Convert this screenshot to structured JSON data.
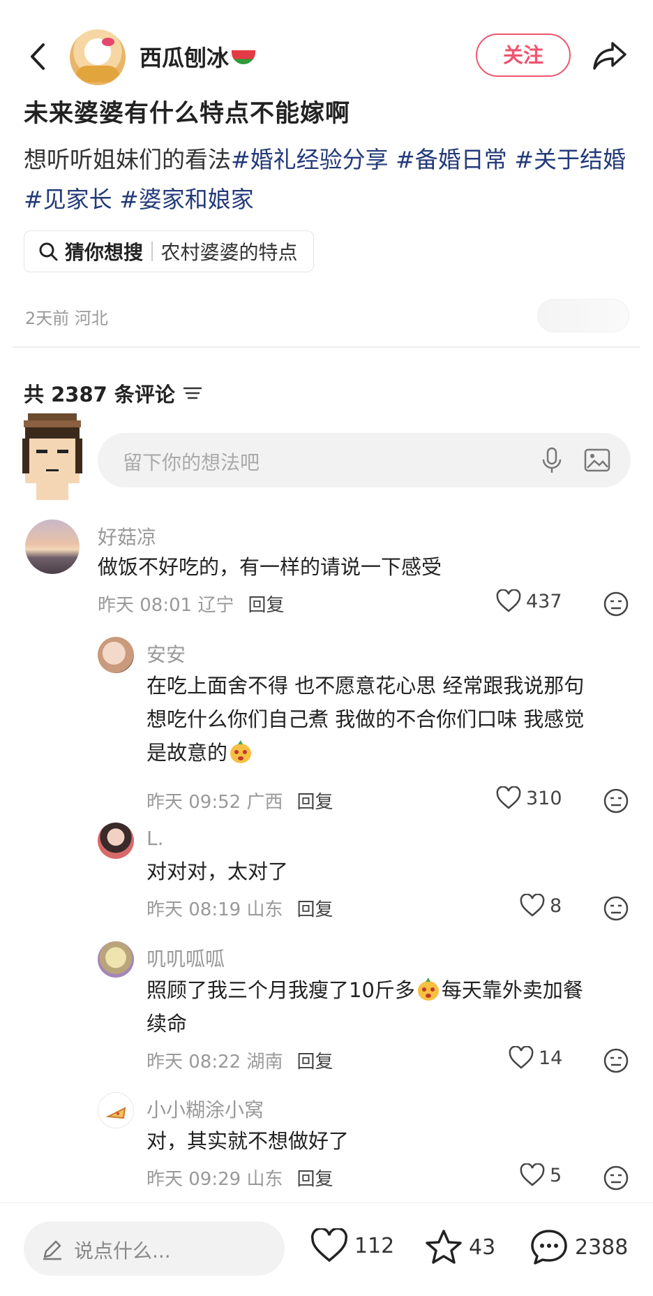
{
  "header": {
    "author_name": "西瓜刨冰",
    "author_emoji": "watermelon-icon",
    "follow_label": "关注"
  },
  "post": {
    "title": "未来婆婆有什么特点不能嫁啊",
    "body_text": "想听听姐妹们的看法",
    "tags": [
      "#婚礼经验分享",
      "#备婚日常",
      "#关于结婚",
      "#见家长",
      "#婆家和娘家"
    ],
    "search_chip": {
      "label": "猜你想搜",
      "value": "农村婆婆的特点"
    },
    "meta": "2天前 河北"
  },
  "comments_section": {
    "count_label": "共 2387 条评论",
    "input_placeholder": "留下你的想法吧"
  },
  "comments": [
    {
      "user": "好菇凉",
      "text": "做饭不好吃的，有一样的请说一下感受",
      "time": "昨天 08:01 辽宁",
      "reply": "回复",
      "likes": "437"
    },
    {
      "user": "安安",
      "text_lines": [
        "在吃上面舍不得 也不愿意花心思 经常跟我说那句",
        "想吃什么你们自己煮 我做的不合你们口味 我感觉",
        "是故意的"
      ],
      "time": "昨天 09:52 广西",
      "reply": "回复",
      "likes": "310"
    },
    {
      "user": "L.",
      "text": "对对对，太对了",
      "time": "昨天 08:19 山东",
      "reply": "回复",
      "likes": "8"
    },
    {
      "user": "叽叽呱呱",
      "text_part1": "照顾了我三个月我瘦了10斤多",
      "text_part2": "每天靠外卖加餐",
      "text_line2": "续命",
      "time": "昨天 08:22 湖南",
      "reply": "回复",
      "likes": "14"
    },
    {
      "user": "小小糊涂小窝",
      "text": "对，其实就不想做好了",
      "time": "昨天 09:29 山东",
      "reply": "回复",
      "likes": "5"
    }
  ],
  "bottom_bar": {
    "input_placeholder": "说点什么...",
    "likes": "112",
    "favorites": "43",
    "comments": "2388"
  },
  "colors": {
    "accent": "#f0546e",
    "tag": "#243b7a",
    "muted": "#999999"
  }
}
